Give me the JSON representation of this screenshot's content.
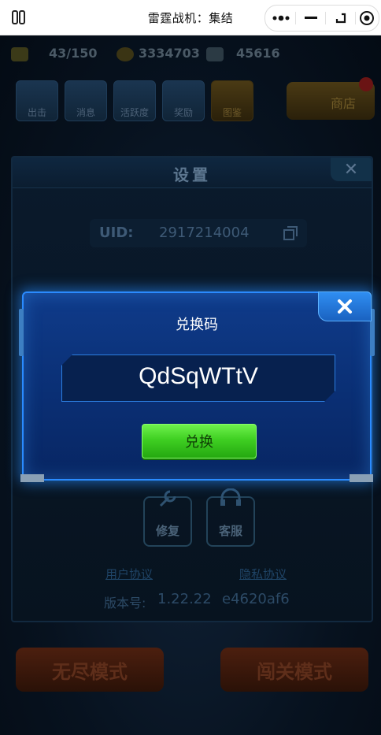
{
  "topbar": {
    "title": "雷霆战机：集结",
    "icons": [
      "sidebar-icon",
      "more-dots-icon",
      "minimize-icon",
      "float-window-icon",
      "close-target-icon"
    ]
  },
  "background": {
    "energy": "43/150",
    "gold": "3334703",
    "gems": "45616",
    "menu": [
      "出击",
      "消息",
      "活跃度",
      "奖励",
      "图鉴"
    ],
    "shop_label": "商店",
    "mode_left": "无尽模式",
    "mode_right": "闯关模式"
  },
  "settings": {
    "title": "设置",
    "uid_label": "UID:",
    "uid_value": "2917214004",
    "repair_label": "修复",
    "service_label": "客服",
    "user_agreement": "用户协议",
    "privacy_policy": "隐私协议",
    "version_label": "版本号:",
    "version_value": "1.22.22",
    "version_hash": "e4620af6"
  },
  "dialog": {
    "title": "兑换码",
    "code_value": "QdSqWTtV",
    "redeem_button": "兑换"
  },
  "colors": {
    "dialog_bg": "#0b3275",
    "dialog_border": "#2a8bff",
    "button_green": "#3fcf22"
  }
}
